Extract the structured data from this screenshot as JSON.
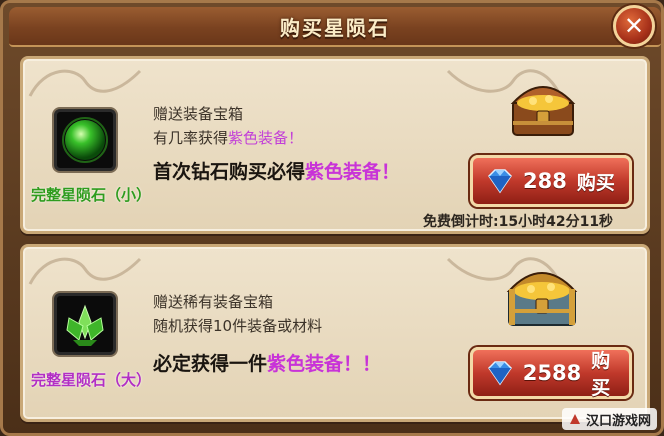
{
  "window": {
    "title": "购买星陨石",
    "close_icon": "close-icon"
  },
  "offers": [
    {
      "gem_name": "完整星陨石（小）",
      "gem_name_color": "#2f9c1e",
      "desc_line1": "赠送装备宝箱",
      "desc_line2_prefix": "有几率获得",
      "desc_line2_highlight": "紫色装备",
      "desc_line2_suffix": "！",
      "promo_prefix": "首次钻石购买必得",
      "promo_highlight": "紫色装备！",
      "price": "288",
      "buy_label": "购买",
      "timer_label": "免费倒计时:",
      "timer_value": "15小时42分11秒"
    },
    {
      "gem_name": "完整星陨石（大）",
      "gem_name_color": "#b22fc4",
      "desc_line1": "赠送稀有装备宝箱",
      "desc_line2": "随机获得10件装备或材料",
      "promo_prefix": "必定获得一件",
      "promo_highlight": "紫色装备！！",
      "price": "2588",
      "buy_label": "购买"
    }
  ],
  "watermark": "汉口游戏网",
  "colors": {
    "highlight_purple": "#c23fd8",
    "button_red": "#c0392b",
    "diamond_blue": "#3a8ee6"
  }
}
